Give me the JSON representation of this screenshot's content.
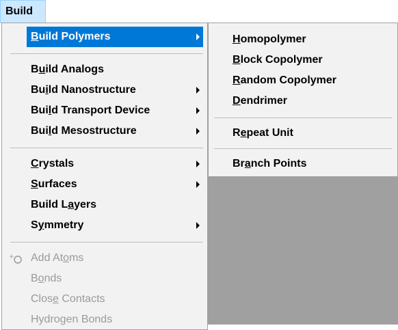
{
  "menubar": {
    "build": "Build"
  },
  "main_menu": {
    "items": [
      {
        "pre": "",
        "u": "B",
        "post": "uild Polymers"
      },
      {
        "pre": "B",
        "u": "u",
        "post": "ild Analogs"
      },
      {
        "pre": "Bu",
        "u": "i",
        "post": "ld Nanostructure"
      },
      {
        "pre": "Bui",
        "u": "l",
        "post": "d Transport Device"
      },
      {
        "pre": "Bui",
        "u": "l",
        "post": "d Mesostructure"
      },
      {
        "pre": "",
        "u": "C",
        "post": "rystals"
      },
      {
        "pre": "",
        "u": "S",
        "post": "urfaces"
      },
      {
        "pre": "Build L",
        "u": "a",
        "post": "yers"
      },
      {
        "pre": "S",
        "u": "y",
        "post": "mmetry"
      },
      {
        "pre": "Add At",
        "u": "o",
        "post": "ms"
      },
      {
        "pre": "B",
        "u": "o",
        "post": "nds"
      },
      {
        "pre": "Clos",
        "u": "e",
        "post": " Contacts"
      },
      {
        "pre": "Hydrogen Bonds",
        "u": "",
        "post": ""
      }
    ]
  },
  "sub_menu": {
    "items": [
      {
        "pre": "",
        "u": "H",
        "post": "omopolymer"
      },
      {
        "pre": "",
        "u": "B",
        "post": "lock Copolymer"
      },
      {
        "pre": "",
        "u": "R",
        "post": "andom Copolymer"
      },
      {
        "pre": "",
        "u": "D",
        "post": "endrimer"
      },
      {
        "pre": "R",
        "u": "e",
        "post": "peat Unit"
      },
      {
        "pre": "Br",
        "u": "a",
        "post": "nch Points"
      }
    ]
  },
  "icons": {
    "add_atoms": "add-atom-icon",
    "submenu_arrow": "chevron-right-icon"
  },
  "colors": {
    "highlight": "#0078d7",
    "menu_bg": "#f2f2f2",
    "menubar_active": "#cce8ff",
    "disabled_text": "#9a9a9a",
    "gray_area": "#a0a0a0"
  }
}
